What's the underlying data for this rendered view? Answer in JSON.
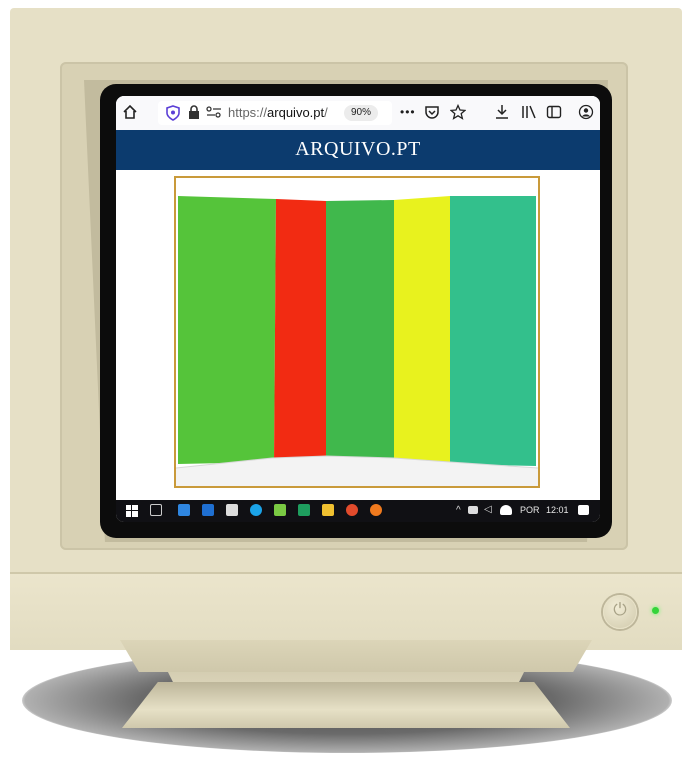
{
  "browser": {
    "url": "https://arquivo.pt/",
    "url_host_prefix": "https://",
    "url_host": "arquivo.pt",
    "url_suffix": "/",
    "zoom": "90%",
    "more_label": "•••"
  },
  "site": {
    "title": "ARQUIVO.PT"
  },
  "artwork": {
    "stripe_colors": [
      "#55c43a",
      "#f22b12",
      "#40b84c",
      "#e8f21e",
      "#33c08c"
    ]
  },
  "taskbar": {
    "language": "POR",
    "time": "12:01"
  },
  "colors": {
    "banner": "#0c3b6e",
    "frame_border": "#c99a3a",
    "monitor_beige": "#e6e0c6",
    "power_led": "#34d43a"
  }
}
